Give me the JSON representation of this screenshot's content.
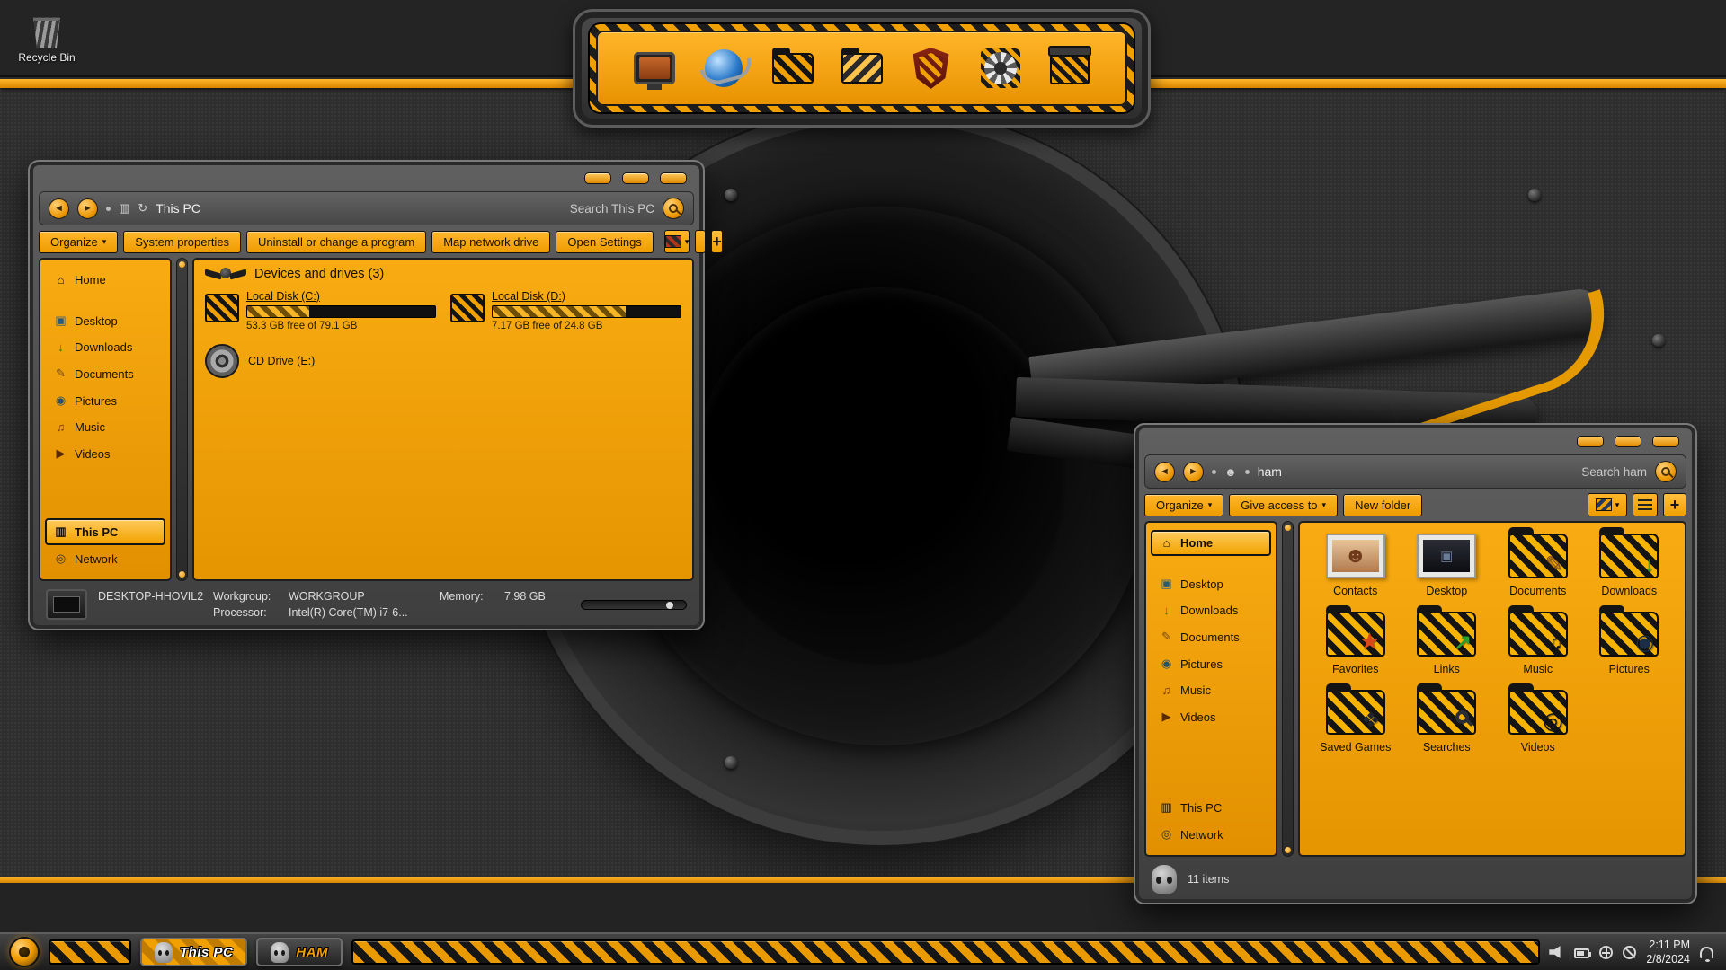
{
  "colors": {
    "accent_orange": "#f0a000",
    "chrome_gray": "#4a4a4a",
    "panel_black": "#161616"
  },
  "desktop": {
    "recycle_bin_label": "Recycle Bin"
  },
  "nav_glyphs": {
    "back": "◄",
    "forward": "►",
    "refresh": "↻",
    "pc_mini": "▥",
    "users_mini": "☻",
    "caret": "▾",
    "plus": "+"
  },
  "window_this_pc": {
    "address": "This PC",
    "search_placeholder": "Search This PC",
    "commands": {
      "organize": "Organize",
      "system_properties": "System properties",
      "uninstall": "Uninstall or change a program",
      "map_network_drive": "Map network drive",
      "open_settings": "Open Settings"
    },
    "sidebar": {
      "items": [
        {
          "label": "Home",
          "glyph": "⌂"
        },
        {
          "label": "Desktop",
          "glyph": "▣"
        },
        {
          "label": "Downloads",
          "glyph": "↓"
        },
        {
          "label": "Documents",
          "glyph": "✎"
        },
        {
          "label": "Pictures",
          "glyph": "◉"
        },
        {
          "label": "Music",
          "glyph": "♫"
        },
        {
          "label": "Videos",
          "glyph": "▶"
        },
        {
          "label": "This PC",
          "glyph": "▥"
        },
        {
          "label": "Network",
          "glyph": "◎"
        }
      ]
    },
    "content": {
      "group_title": "Devices and drives (3)",
      "drives": [
        {
          "name": "Local Disk (C:)",
          "free_text": "53.3 GB free of 79.1 GB",
          "used_percent": 33
        },
        {
          "name": "Local Disk (D:)",
          "free_text": "7.17 GB free of 24.8 GB",
          "used_percent": 71
        },
        {
          "name": "CD Drive (E:)",
          "free_text": "",
          "used_percent": 0
        }
      ]
    },
    "status": {
      "computer_name": "DESKTOP-HHOVIL2",
      "workgroup_label": "Workgroup:",
      "workgroup_value": "WORKGROUP",
      "memory_label": "Memory:",
      "memory_value": "7.98 GB",
      "processor_label": "Processor:",
      "processor_value": "Intel(R) Core(TM) i7-6..."
    }
  },
  "window_ham": {
    "address": "ham",
    "search_placeholder": "Search ham",
    "commands": {
      "organize": "Organize",
      "give_access": "Give access to",
      "new_folder": "New folder"
    },
    "sidebar": {
      "items": [
        {
          "label": "Home",
          "glyph": "⌂"
        },
        {
          "label": "Desktop",
          "glyph": "▣"
        },
        {
          "label": "Downloads",
          "glyph": "↓"
        },
        {
          "label": "Documents",
          "glyph": "✎"
        },
        {
          "label": "Pictures",
          "glyph": "◉"
        },
        {
          "label": "Music",
          "glyph": "♫"
        },
        {
          "label": "Videos",
          "glyph": "▶"
        },
        {
          "label": "This PC",
          "glyph": "▥"
        },
        {
          "label": "Network",
          "glyph": "◎"
        }
      ]
    },
    "folders": [
      {
        "label": "Contacts",
        "glyph": "☻"
      },
      {
        "label": "Desktop",
        "glyph": "▣"
      },
      {
        "label": "Documents",
        "glyph": "✎"
      },
      {
        "label": "Downloads",
        "glyph": "↓"
      },
      {
        "label": "Favorites",
        "glyph": "★"
      },
      {
        "label": "Links",
        "glyph": "↗"
      },
      {
        "label": "Music",
        "glyph": "♫"
      },
      {
        "label": "Pictures",
        "glyph": "◉"
      },
      {
        "label": "Saved Games",
        "glyph": "❖"
      },
      {
        "label": "Searches",
        "glyph": ""
      },
      {
        "label": "Videos",
        "glyph": "◎"
      }
    ],
    "status": {
      "items_count": "11 items"
    }
  },
  "taskbar": {
    "task_buttons": [
      {
        "label": "This PC"
      },
      {
        "label": "HAM"
      }
    ],
    "tray": {
      "time": "2:11 PM",
      "date": "2/8/2024"
    }
  }
}
